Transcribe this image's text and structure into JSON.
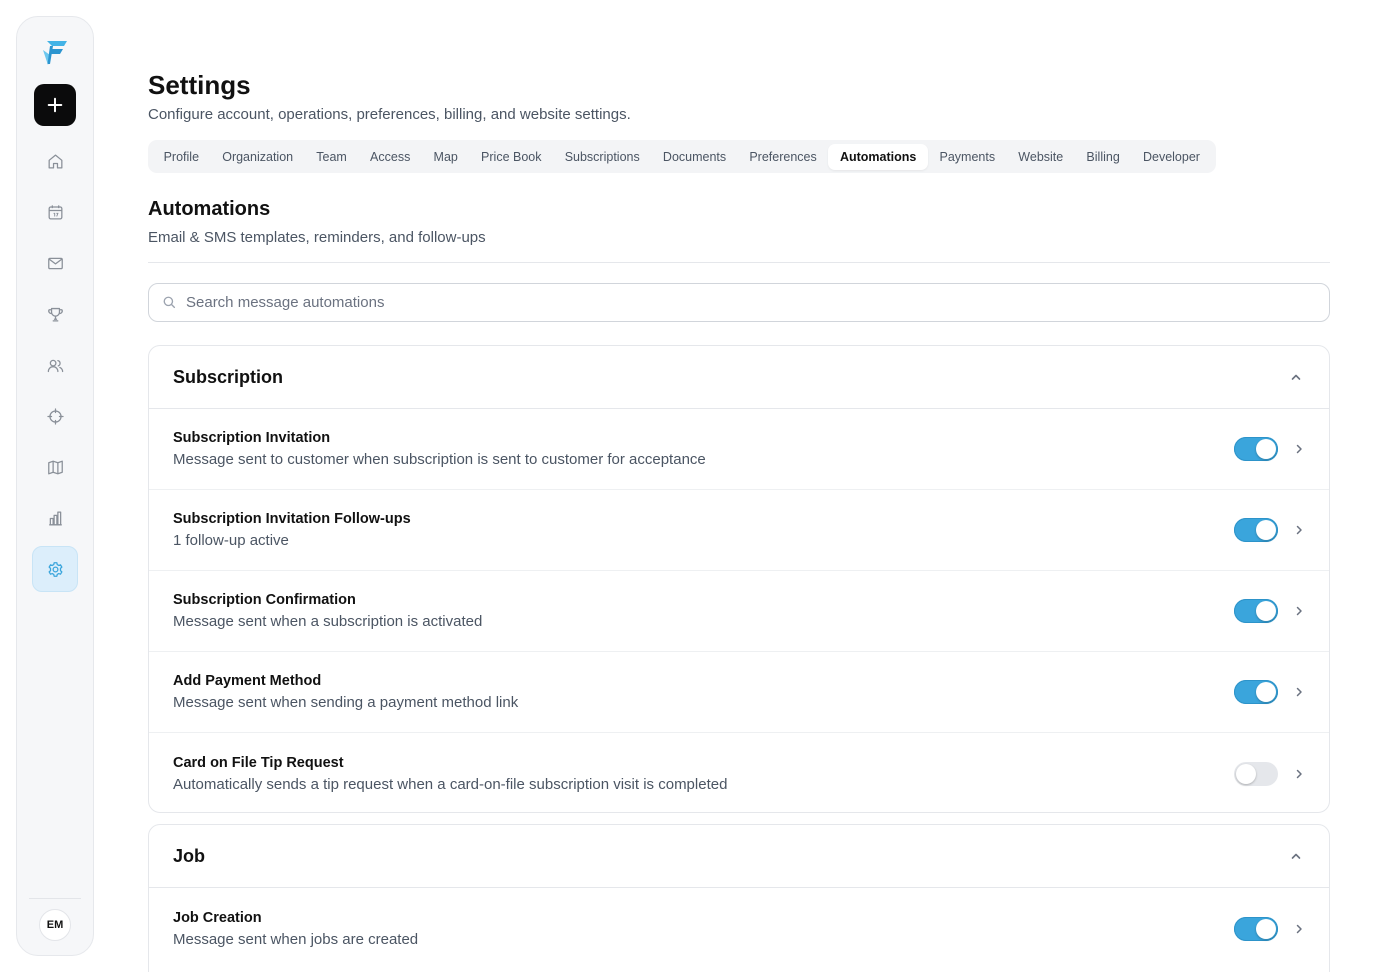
{
  "sidebar": {
    "avatar_initials": "EM",
    "items": [
      {
        "icon": "home-icon"
      },
      {
        "icon": "calendar-icon"
      },
      {
        "icon": "mail-icon"
      },
      {
        "icon": "trophy-icon"
      },
      {
        "icon": "users-icon"
      },
      {
        "icon": "crosshair-icon"
      },
      {
        "icon": "map-icon"
      },
      {
        "icon": "bar-chart-icon"
      },
      {
        "icon": "gear-icon",
        "active": true
      }
    ]
  },
  "header": {
    "title": "Settings",
    "subtitle": "Configure account, operations, preferences, billing, and website settings."
  },
  "tabs": [
    "Profile",
    "Organization",
    "Team",
    "Access",
    "Map",
    "Price Book",
    "Subscriptions",
    "Documents",
    "Preferences",
    "Automations",
    "Payments",
    "Website",
    "Billing",
    "Developer"
  ],
  "active_tab": "Automations",
  "section": {
    "title": "Automations",
    "subtitle": "Email & SMS templates, reminders, and follow-ups"
  },
  "search": {
    "placeholder": "Search message automations",
    "value": ""
  },
  "groups": [
    {
      "title": "Subscription",
      "expanded": true,
      "items": [
        {
          "title": "Subscription Invitation",
          "description": "Message sent to customer when subscription is sent to customer for acceptance",
          "enabled": true
        },
        {
          "title": "Subscription Invitation Follow-ups",
          "description": "1 follow-up active",
          "enabled": true
        },
        {
          "title": "Subscription Confirmation",
          "description": "Message sent when a subscription is activated",
          "enabled": true
        },
        {
          "title": "Add Payment Method",
          "description": "Message sent when sending a payment method link",
          "enabled": true
        },
        {
          "title": "Card on File Tip Request",
          "description": "Automatically sends a tip request when a card-on-file subscription visit is completed",
          "enabled": false
        }
      ]
    },
    {
      "title": "Job",
      "expanded": true,
      "items": [
        {
          "title": "Job Creation",
          "description": "Message sent when jobs are created",
          "enabled": true
        }
      ]
    }
  ],
  "colors": {
    "accent": "#3aa5dc",
    "active_nav_bg": "#dceefb",
    "toggle_off": "#e5e7eb"
  }
}
